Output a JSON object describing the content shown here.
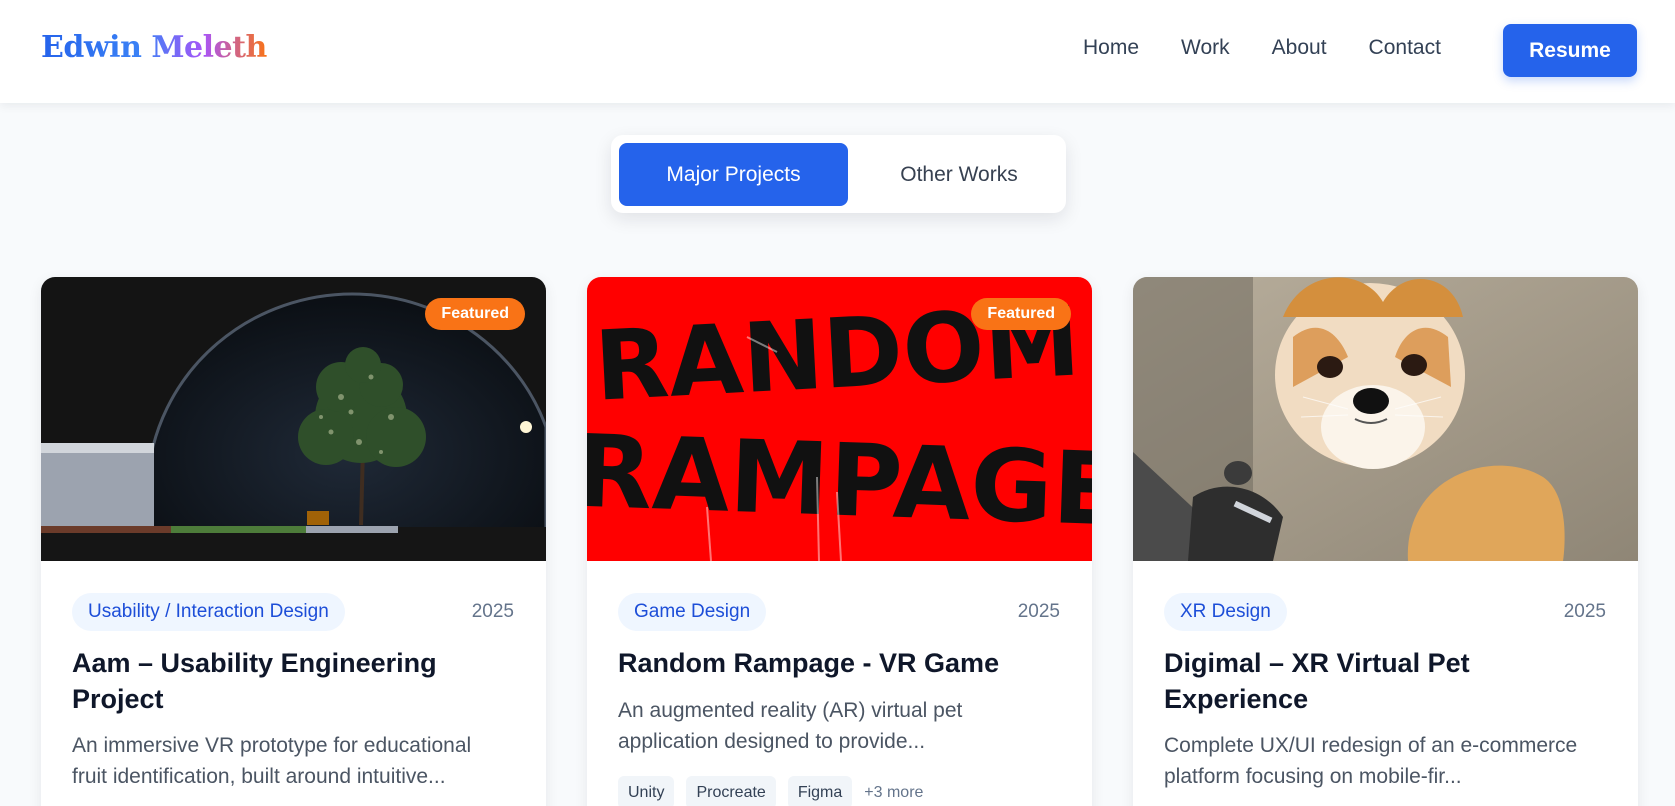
{
  "header": {
    "logo": "Edwin Meleth",
    "nav": [
      "Home",
      "Work",
      "About",
      "Contact"
    ],
    "resume_label": "Resume"
  },
  "tabs": {
    "active": "Major Projects",
    "inactive": "Other Works"
  },
  "cards": [
    {
      "featured": "Featured",
      "category": "Usability / Interaction Design",
      "year": "2025",
      "title": "Aam – Usability Engineering Project",
      "description": "An immersive VR prototype for educational fruit identification, built around intuitive..."
    },
    {
      "featured": "Featured",
      "category": "Game Design",
      "year": "2025",
      "title": "Random Rampage - VR Game",
      "description": "An augmented reality (AR) virtual pet application designed to provide...",
      "tags": [
        "Unity",
        "Procreate",
        "Figma"
      ],
      "more": "+3 more",
      "image_text": [
        "RANDOM",
        "RAMPAGE"
      ]
    },
    {
      "category": "XR Design",
      "year": "2025",
      "title": "Digimal – XR Virtual Pet Experience",
      "description": "Complete UX/UI redesign of an e-commerce platform focusing on mobile-fir..."
    }
  ]
}
